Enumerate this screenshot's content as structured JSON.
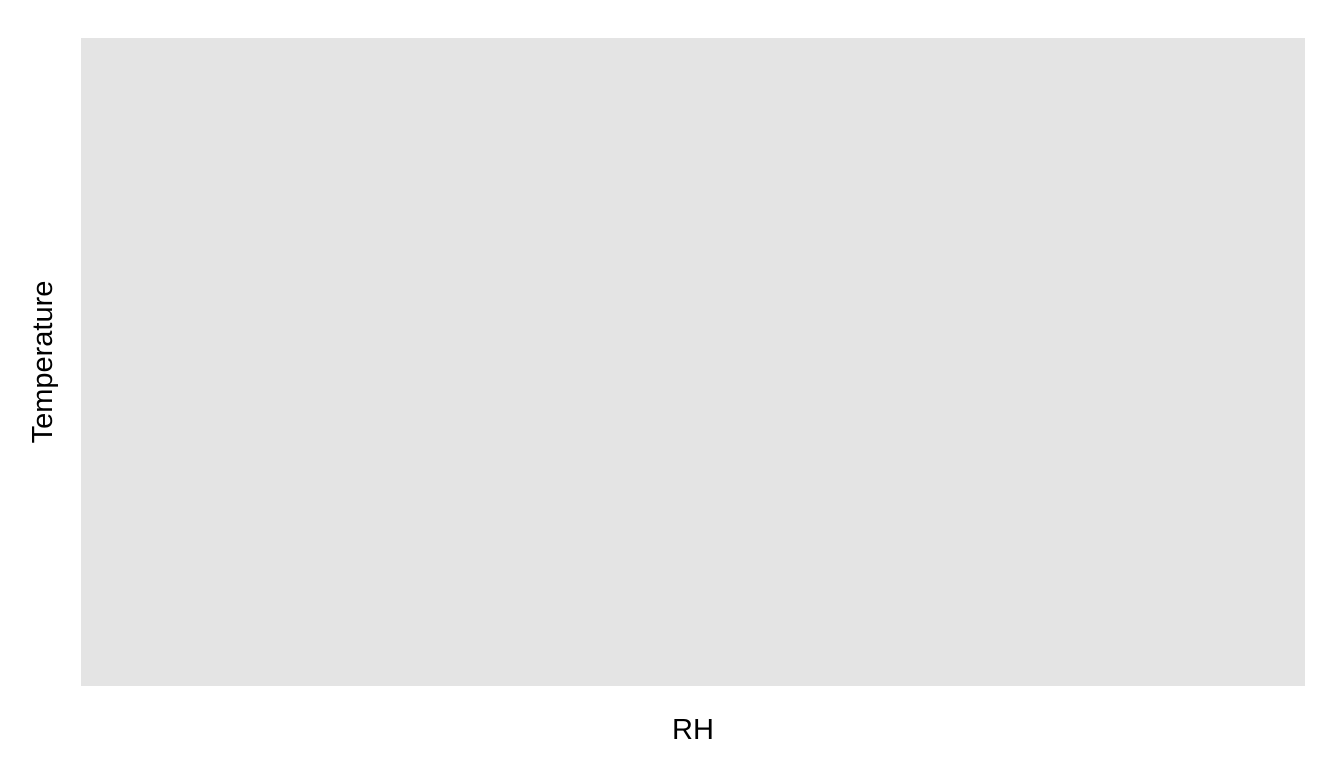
{
  "chart_data": {
    "type": "scatter",
    "title": "",
    "xlabel": "RH",
    "ylabel": "Temperature",
    "series": [],
    "grid": false,
    "legend": "none"
  },
  "colors": {
    "panel_background": "#E4E4E4",
    "page_background": "#FFFFFF",
    "text": "#000000"
  }
}
